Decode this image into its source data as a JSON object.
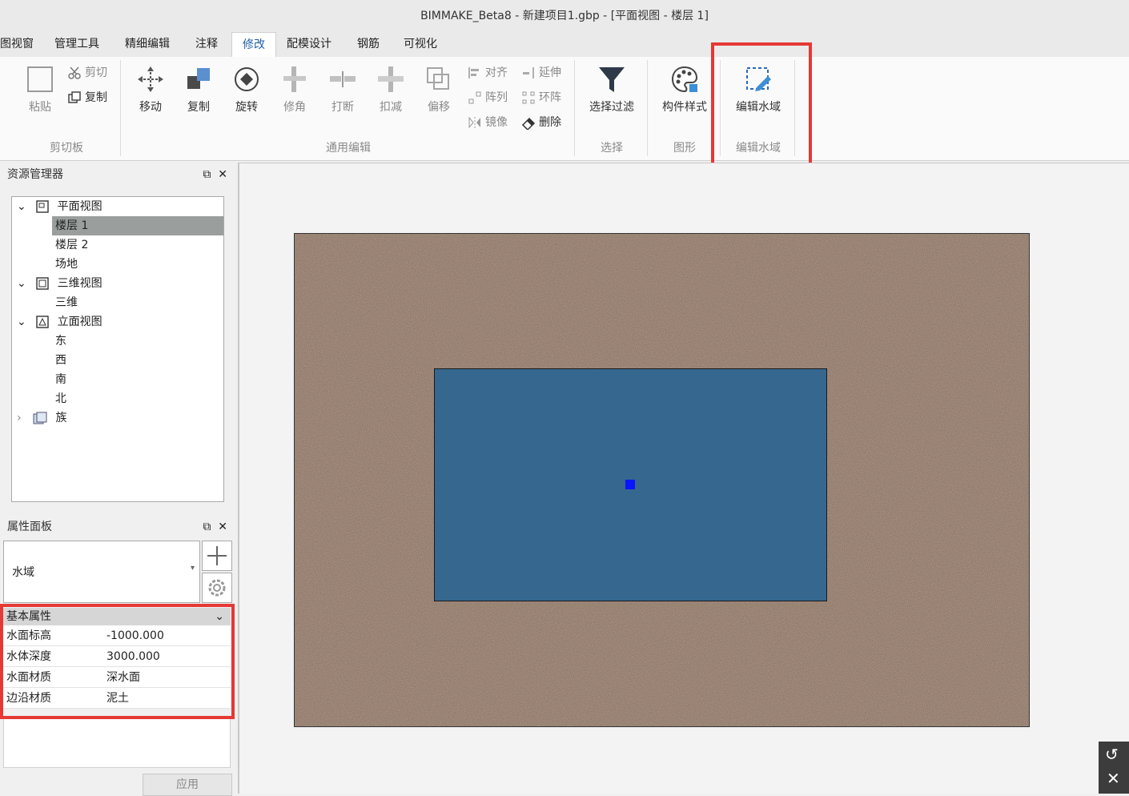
{
  "window": {
    "title": "BIMMAKE_Beta8 - 新建项目1.gbp - [平面视图 - 楼层 1]"
  },
  "menu": {
    "tabs": [
      {
        "label": "图视窗",
        "active": false
      },
      {
        "label": "管理工具",
        "active": false
      },
      {
        "label": "精细编辑",
        "active": false
      },
      {
        "label": "注释",
        "active": false
      },
      {
        "label": "修改",
        "active": true
      },
      {
        "label": "配模设计",
        "active": false
      },
      {
        "label": "钢筋",
        "active": false
      },
      {
        "label": "可视化",
        "active": false
      }
    ]
  },
  "ribbon": {
    "clipboard": {
      "group_label": "剪切板",
      "paste": "粘贴",
      "cut": "剪切",
      "copy": "复制"
    },
    "edit": {
      "group_label": "通用编辑",
      "move": "移动",
      "copy": "复制",
      "rotate": "旋转",
      "trim": "修角",
      "split": "打断",
      "subtract": "扣减",
      "offset": "偏移",
      "align": "对齐",
      "array": "阵列",
      "mirror": "镜像",
      "extend": "延伸",
      "ring_array": "环阵",
      "delete": "删除"
    },
    "select": {
      "group_label": "选择",
      "filter": "选择过滤"
    },
    "graphics": {
      "group_label": "图形",
      "component_style": "构件样式"
    },
    "water": {
      "group_label": "编辑水域",
      "edit_water": "编辑水域"
    }
  },
  "highlight_color": "#e53935",
  "resource_panel": {
    "title": "资源管理器",
    "tree": [
      {
        "label": "平面视图",
        "level": 0,
        "expanded": true,
        "icon": "plan-view-icon"
      },
      {
        "label": "楼层 1",
        "level": 1,
        "selected": true
      },
      {
        "label": "楼层 2",
        "level": 1
      },
      {
        "label": "场地",
        "level": 1
      },
      {
        "label": "三维视图",
        "level": 0,
        "expanded": true,
        "icon": "3d-view-icon"
      },
      {
        "label": "三维",
        "level": 1
      },
      {
        "label": "立面视图",
        "level": 0,
        "expanded": true,
        "icon": "elevation-view-icon"
      },
      {
        "label": "东",
        "level": 1
      },
      {
        "label": "西",
        "level": 1
      },
      {
        "label": "南",
        "level": 1
      },
      {
        "label": "北",
        "level": 1
      },
      {
        "label": "族",
        "level": 0,
        "expanded": false,
        "icon": "family-icon"
      }
    ]
  },
  "properties_panel": {
    "title": "属性面板",
    "type_value": "水域",
    "section_title": "基本属性",
    "rows": [
      {
        "key": "水面标高",
        "value": "-1000.000"
      },
      {
        "key": "水体深度",
        "value": "3000.000"
      },
      {
        "key": "水面材质",
        "value": "深水面"
      },
      {
        "key": "边沿材质",
        "value": "泥土"
      }
    ],
    "apply_label": "应用"
  },
  "canvas": {
    "terrain_color": "#8a7262",
    "water_color": "#35678f",
    "handle_color": "#0a14ff"
  }
}
